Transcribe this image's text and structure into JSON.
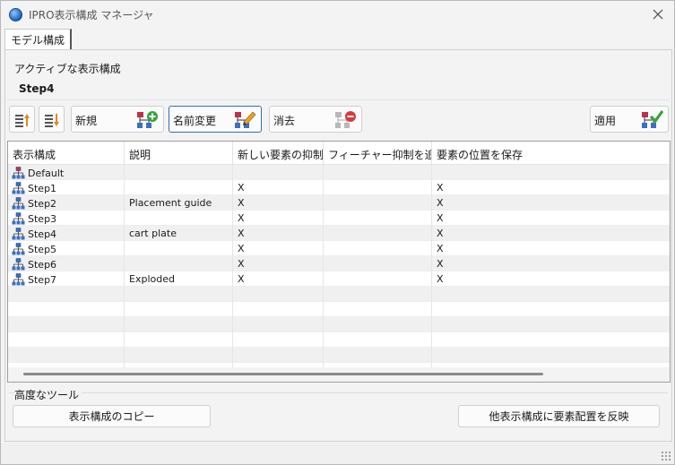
{
  "window": {
    "title": "IPRO表示構成 マネージャ"
  },
  "tabs": [
    {
      "label": "モデル構成"
    }
  ],
  "active_config": {
    "label": "アクティブな表示構成",
    "value": "Step4"
  },
  "toolbar": {
    "new_label": "新規",
    "rename_label": "名前変更",
    "delete_label": "消去",
    "apply_label": "適用"
  },
  "table": {
    "columns": [
      "表示構成",
      "説明",
      "新しい要素の抑制",
      "フィーチャー抑制を追跡",
      "要素の位置を保存"
    ],
    "rows": [
      {
        "name": "Default",
        "description": "",
        "suppress_new": "",
        "track_feature": "",
        "save_position": ""
      },
      {
        "name": "Step1",
        "description": "",
        "suppress_new": "X",
        "track_feature": "",
        "save_position": "X"
      },
      {
        "name": "Step2",
        "description": "Placement guide",
        "suppress_new": "X",
        "track_feature": "",
        "save_position": "X"
      },
      {
        "name": "Step3",
        "description": "",
        "suppress_new": "X",
        "track_feature": "",
        "save_position": "X"
      },
      {
        "name": "Step4",
        "description": "cart plate",
        "suppress_new": "X",
        "track_feature": "",
        "save_position": "X"
      },
      {
        "name": "Step5",
        "description": "",
        "suppress_new": "X",
        "track_feature": "",
        "save_position": "X"
      },
      {
        "name": "Step6",
        "description": "",
        "suppress_new": "X",
        "track_feature": "",
        "save_position": "X"
      },
      {
        "name": "Step7",
        "description": "Exploded",
        "suppress_new": "X",
        "track_feature": "",
        "save_position": "X"
      }
    ],
    "empty_rows": 6
  },
  "advanced": {
    "label": "高度なツール",
    "copy_button": "表示構成のコピー",
    "reflect_button": "他表示構成に要素配置を反映"
  },
  "colors": {
    "selected_border": "#2f6fb3",
    "alt_row": "#f0f0f0"
  }
}
